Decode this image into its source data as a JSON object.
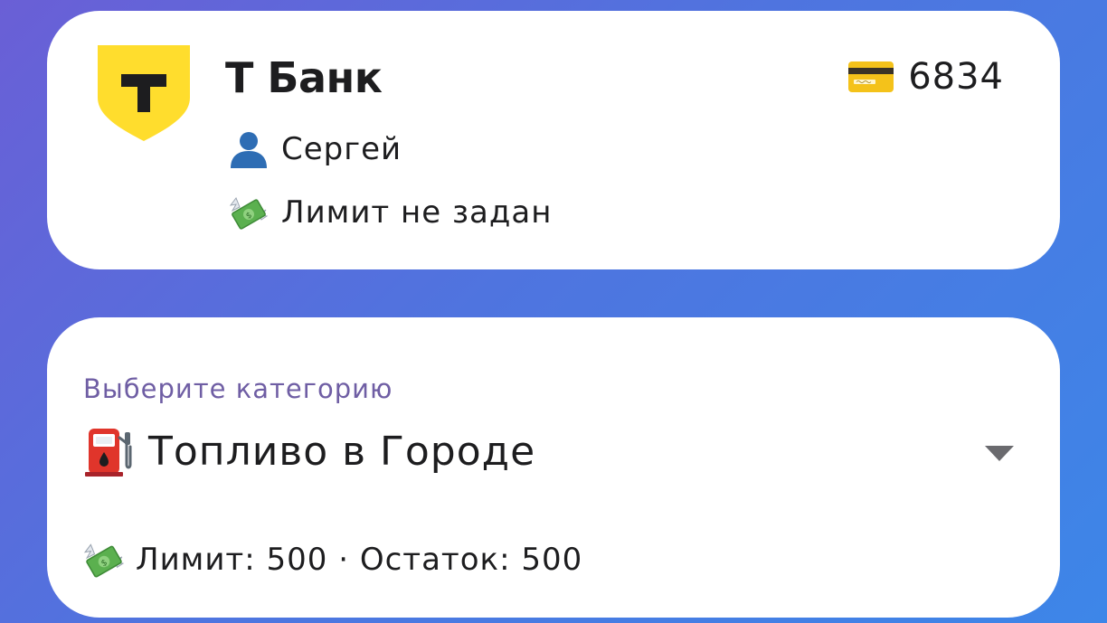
{
  "bank": {
    "title": "Т Банк",
    "logo_letter": "T",
    "logo_color": "#ffdd2d",
    "user_icon": "person-icon",
    "user_name": "Сергей",
    "limit_icon": "money-with-wings-icon",
    "limit_text": "Лимит не задан",
    "card_icon": "credit-card-icon",
    "card_number": "6834"
  },
  "category": {
    "label": "Выберите категорию",
    "selected_icon": "fuel-pump-icon",
    "selected_value": "Топливо в Городе",
    "dropdown_icon": "triangle-down-icon",
    "limit_icon": "money-with-wings-icon",
    "limit_label": "Лимит:",
    "limit_value": "500",
    "separator": "·",
    "remaining_label": "Остаток:",
    "remaining_value": "500"
  },
  "colors": {
    "background_start": "#6a5fd6",
    "background_end": "#3d86e8",
    "label_purple": "#6f5ea4",
    "card_white": "#ffffff"
  }
}
